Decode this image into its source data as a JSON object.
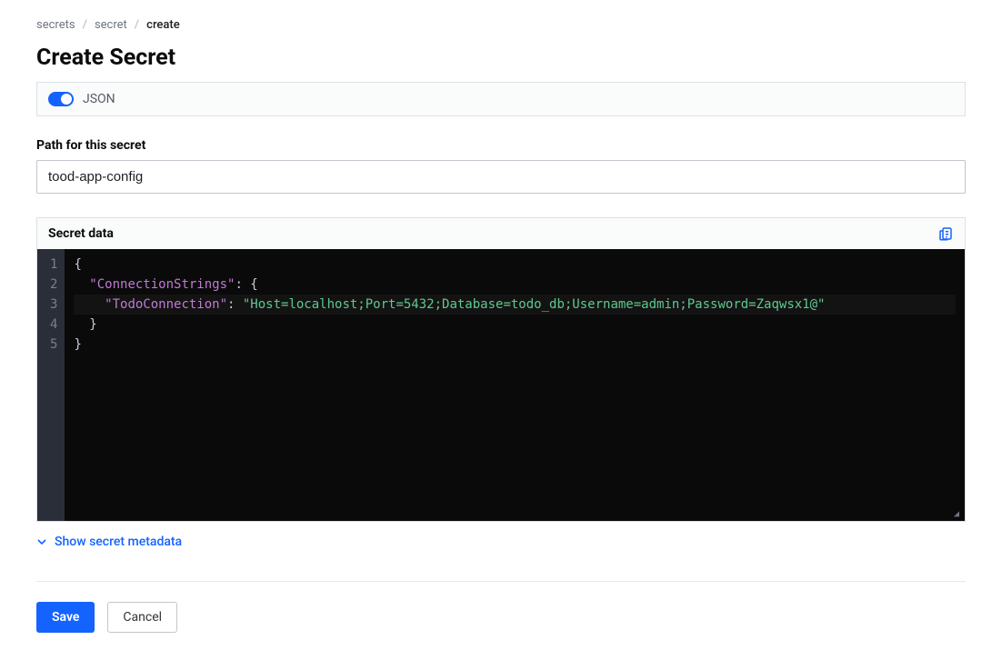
{
  "breadcrumb": {
    "items": [
      "secrets",
      "secret"
    ],
    "current": "create"
  },
  "page_title": "Create Secret",
  "toggle": {
    "label": "JSON",
    "on": true
  },
  "path_field": {
    "label": "Path for this secret",
    "value": "tood-app-config"
  },
  "secret_data": {
    "header": "Secret data",
    "lines": [
      {
        "num": "1",
        "tokens": [
          {
            "t": "brace",
            "v": "{"
          }
        ]
      },
      {
        "num": "2",
        "tokens": [
          {
            "t": "plain",
            "v": "  "
          },
          {
            "t": "key",
            "v": "\"ConnectionStrings\""
          },
          {
            "t": "brace",
            "v": ": {"
          }
        ]
      },
      {
        "num": "3",
        "cursor": true,
        "tokens": [
          {
            "t": "plain",
            "v": "    "
          },
          {
            "t": "key",
            "v": "\"TodoConnection\""
          },
          {
            "t": "brace",
            "v": ": "
          },
          {
            "t": "str",
            "v": "\"Host=localhost;Port=5432;Database=todo_db;Username=admin;Password=Zaqwsx1@\""
          }
        ]
      },
      {
        "num": "4",
        "tokens": [
          {
            "t": "plain",
            "v": "  "
          },
          {
            "t": "brace",
            "v": "}"
          }
        ]
      },
      {
        "num": "5",
        "tokens": [
          {
            "t": "brace",
            "v": "}"
          }
        ]
      }
    ]
  },
  "metadata_toggle": {
    "label": "Show secret metadata"
  },
  "actions": {
    "save": "Save",
    "cancel": "Cancel"
  }
}
